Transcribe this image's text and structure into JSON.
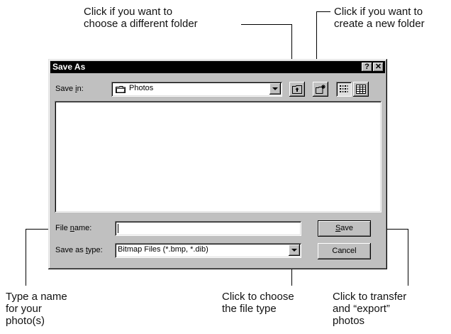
{
  "callouts": {
    "folder_change": "Click if you want to\nchoose a different folder",
    "new_folder": "Click if you want to\ncreate a new folder",
    "file_name": "Type a name\nfor your\nphoto(s)",
    "file_type": "Click to choose\nthe file type",
    "save": "Click to transfer\nand “export”\nphotos"
  },
  "dialog": {
    "title": "Save As",
    "help_button": "?",
    "close_button": "✕",
    "save_in_label_pre": "Save ",
    "save_in_label_accel": "i",
    "save_in_label_post": "n:",
    "save_in_value": "Photos",
    "file_name_label_pre": "File ",
    "file_name_label_accel": "n",
    "file_name_label_post": "ame:",
    "file_name_value": "",
    "save_as_type_label_pre": "Save as ",
    "save_as_type_label_accel": "t",
    "save_as_type_label_post": "ype:",
    "save_as_type_value": "Bitmap Files (*.bmp, *.dib)",
    "save_button_accel": "S",
    "save_button_rest": "ave",
    "cancel_button": "Cancel"
  }
}
